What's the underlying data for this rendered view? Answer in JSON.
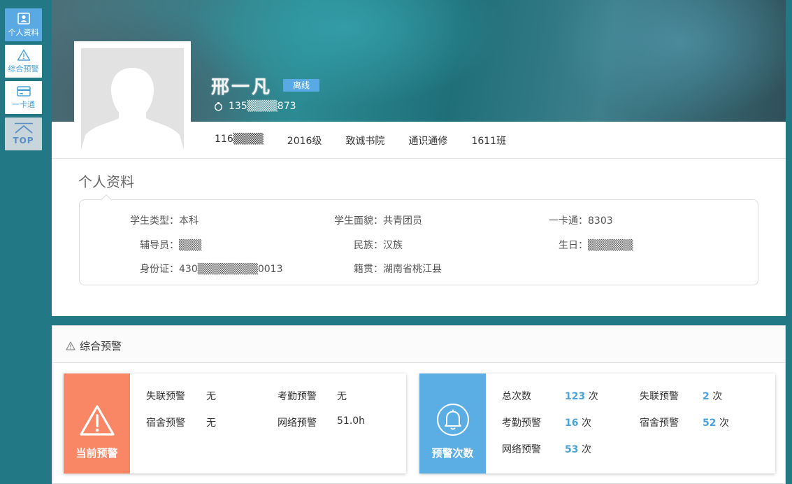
{
  "colors": {
    "accent_blue": "#5aa9e2",
    "warning_orange": "#f98664",
    "count_blue": "#5aaee4",
    "banner_teal": "#227885"
  },
  "sidenav": {
    "items": [
      {
        "label": "个人资料",
        "icon": "user-card-icon"
      },
      {
        "label": "综合预警",
        "icon": "warning-icon"
      },
      {
        "label": "一卡通",
        "icon": "card-icon"
      },
      {
        "label": "TOP",
        "icon": "chevron-up-icon"
      }
    ]
  },
  "header": {
    "name": "邢一凡",
    "status": "离线",
    "phone": "135▒▒▒▒873",
    "info": [
      "116▒▒▒▒",
      "2016级",
      "致诚书院",
      "通识通修",
      "1611班"
    ]
  },
  "profile": {
    "title": "个人资料",
    "fields": [
      {
        "label": "学生类型：",
        "value": "本科"
      },
      {
        "label": "学生面貌：",
        "value": "共青团员"
      },
      {
        "label": "一卡通：",
        "value": "8303"
      },
      {
        "label": "辅导员：",
        "value": "▒▒▒"
      },
      {
        "label": "民族：",
        "value": "汉族"
      },
      {
        "label": "生日：",
        "value": "▒▒▒▒▒▒"
      },
      {
        "label": "身份证：",
        "value": "430▒▒▒▒▒▒▒▒0013"
      },
      {
        "label": "籍贯：",
        "value": "湖南省桃江县"
      }
    ]
  },
  "warning": {
    "title": "综合预警",
    "current": {
      "label": "当前预警",
      "items": [
        {
          "name": "失联预警",
          "value": "无"
        },
        {
          "name": "考勤预警",
          "value": "无"
        },
        {
          "name": "宿舍预警",
          "value": "无"
        },
        {
          "name": "网络预警",
          "value": "51.0h"
        }
      ]
    },
    "counts": {
      "label": "预警次数",
      "unit": "次",
      "items": [
        {
          "name": "总次数",
          "value": "123"
        },
        {
          "name": "失联预警",
          "value": "2"
        },
        {
          "name": "考勤预警",
          "value": "16"
        },
        {
          "name": "宿舍预警",
          "value": "52"
        },
        {
          "name": "网络预警",
          "value": "53"
        }
      ]
    }
  }
}
